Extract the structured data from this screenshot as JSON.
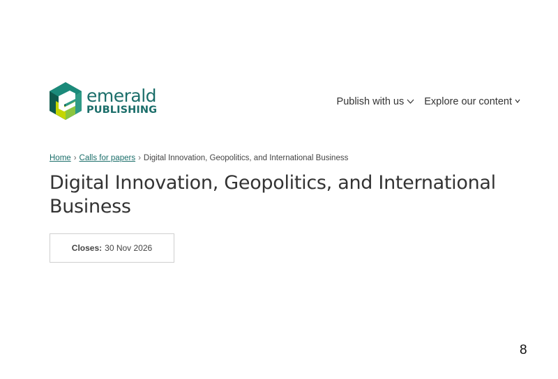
{
  "brand": {
    "word": "emerald",
    "sub": "PUBLISHING",
    "colors": {
      "teal": "#1b6e6a",
      "dark_green": "#0f4e43",
      "lime": "#c4d600",
      "green": "#6cab3b"
    }
  },
  "nav": {
    "items": [
      {
        "label": "Publish with us",
        "icon": "chevron-down-icon"
      },
      {
        "label": "Explore our content",
        "icon": "chevron-down-icon"
      }
    ]
  },
  "breadcrumb": {
    "items": [
      {
        "label": "Home",
        "link": true
      },
      {
        "label": "Calls for papers",
        "link": true
      },
      {
        "label": "Digital Innovation, Geopolitics, and International Business",
        "link": false
      }
    ],
    "separator": "›"
  },
  "page": {
    "title": "Digital Innovation, Geopolitics, and International Business",
    "closes_label": "Closes:",
    "closes_value": "30 Nov 2026"
  },
  "slide_number": "8"
}
